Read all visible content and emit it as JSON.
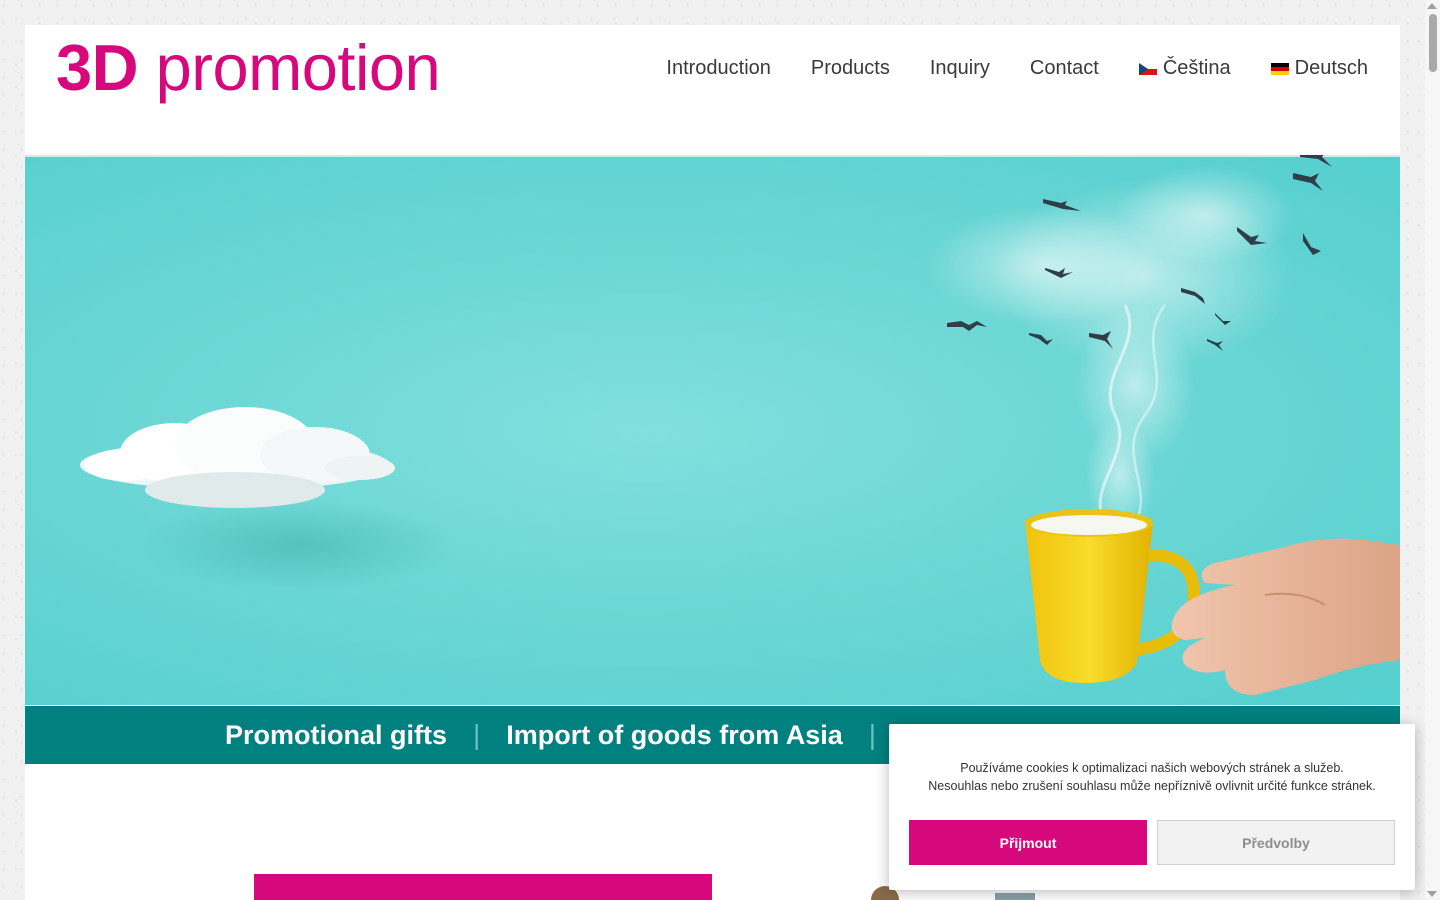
{
  "header": {
    "logo_bold": "3D",
    "logo_rest": " promotion"
  },
  "nav": {
    "items": [
      {
        "label": "Introduction"
      },
      {
        "label": "Products"
      },
      {
        "label": "Inquiry"
      },
      {
        "label": "Contact"
      },
      {
        "label": "Čeština",
        "flag": "czech-flag-icon"
      },
      {
        "label": "Deutsch",
        "flag": "german-flag-icon"
      }
    ]
  },
  "tagline": {
    "items": [
      "Promotional gifts",
      "Import of goods from Asia"
    ],
    "separator": "|"
  },
  "cookie_banner": {
    "line1": "Používáme cookies k optimalizaci našich webových stránek a služeb.",
    "line2": "Nesouhlas nebo zrušení souhlasu může nepříznivě ovlivnit určité funkce stránek.",
    "accept_label": "Přijmout",
    "preferences_label": "Předvolby"
  },
  "colors": {
    "brand_magenta": "#d6087c",
    "hero_teal": "#6ed8d6",
    "tagbar_teal": "#00807f",
    "mug_yellow": "#f5d21b"
  },
  "hero_image": {
    "icons": [
      "cloud-icon",
      "birds-icon",
      "steam-icon",
      "coffee-mug-icon",
      "hand-icon"
    ]
  }
}
